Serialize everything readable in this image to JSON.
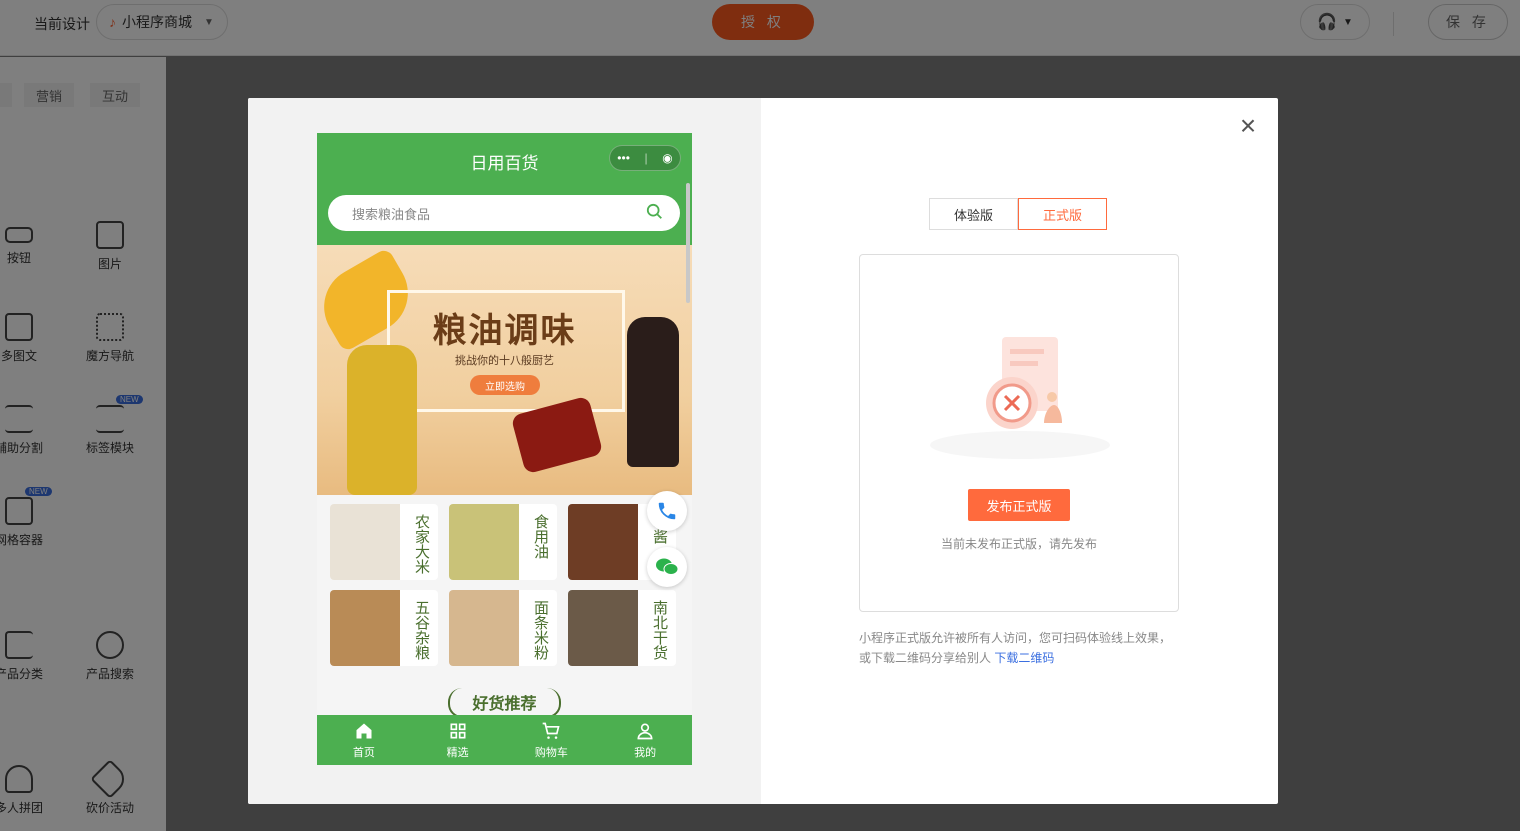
{
  "topbar": {
    "current_design_label": "当前设计",
    "design_name": "小程序商城",
    "auth_label": "授 权",
    "save_label": "保 存"
  },
  "left_panel": {
    "tabs": [
      "营销",
      "互动"
    ],
    "components": [
      {
        "label": "按钮",
        "icon": "button-icon"
      },
      {
        "label": "图片",
        "icon": "image-icon"
      },
      {
        "label": "多图文",
        "icon": "multi-image-text-icon"
      },
      {
        "label": "魔方导航",
        "icon": "cube-nav-icon"
      },
      {
        "label": "辅助分割",
        "icon": "divider-icon"
      },
      {
        "label": "标签模块",
        "icon": "tag-module-icon",
        "badge": "NEW"
      },
      {
        "label": "网格容器",
        "icon": "grid-container-icon",
        "badge": "NEW"
      },
      {
        "label": "产品分类",
        "icon": "product-category-icon"
      },
      {
        "label": "产品搜索",
        "icon": "product-search-icon"
      },
      {
        "label": "多人拼团",
        "icon": "group-buy-icon"
      },
      {
        "label": "砍价活动",
        "icon": "bargain-icon"
      }
    ]
  },
  "phone": {
    "title": "日用百货",
    "search_placeholder": "搜索粮油食品",
    "banner": {
      "title": "粮油调味",
      "subtitle": "挑战你的十八般厨艺",
      "cta": "立即选购"
    },
    "categories": [
      "农家大米",
      "食用油",
      "味酱",
      "五谷杂粮",
      "面条米粉",
      "南北干货"
    ],
    "section_title": "好货推荐",
    "tabbar": [
      "首页",
      "精选",
      "购物车",
      "我的"
    ]
  },
  "publish": {
    "tabs": [
      "体验版",
      "正式版"
    ],
    "active_tab": "正式版",
    "button": "发布正式版",
    "tip": "当前未发布正式版，请先发布",
    "desc": "小程序正式版允许被所有人访问，您可扫码体验线上效果，或下载二维码分享给别人",
    "download_link": "下载二维码"
  },
  "colors": {
    "primary_green": "#4caf50",
    "accent_orange": "#ff6a3d",
    "link_blue": "#3b6fe0"
  }
}
